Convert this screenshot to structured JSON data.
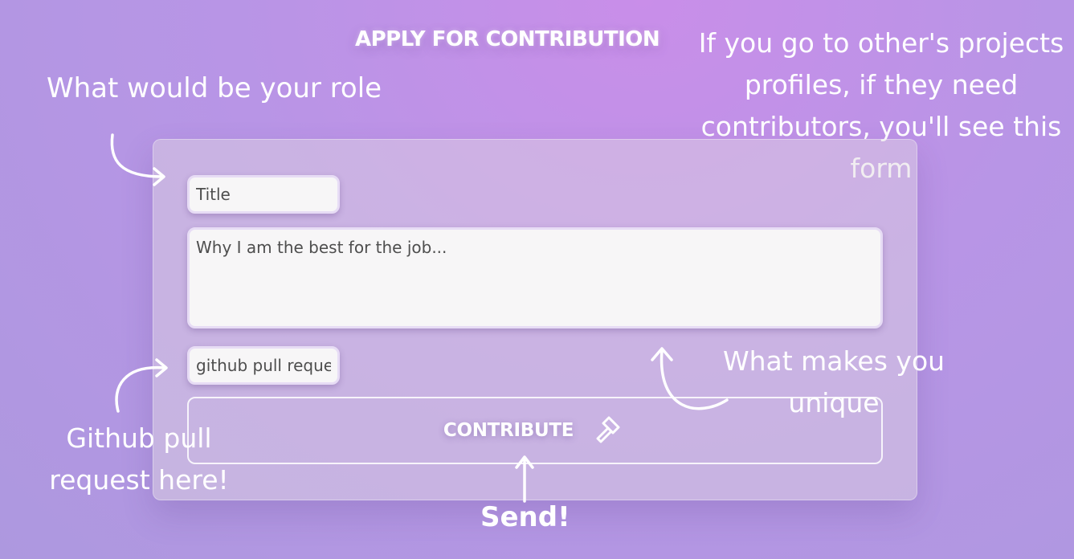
{
  "heading": "APPLY FOR CONTRIBUTION",
  "annotations": {
    "role": "What would be your role",
    "other_profiles": "If you go to other's projects profiles, if they need contributors, you'll see this form",
    "unique": "What makes you unique",
    "github": "Github pull request here!",
    "send": "Send!"
  },
  "form": {
    "title_placeholder": "Title",
    "why_placeholder": "Why I am the best for the job...",
    "github_placeholder": "github pull request",
    "contribute_label": "CONTRIBUTE"
  },
  "icons": {
    "contribute": "hammer-icon"
  },
  "colors": {
    "background": "#b895e6",
    "text": "#ffffff",
    "field_border": "#e7dcf5"
  }
}
